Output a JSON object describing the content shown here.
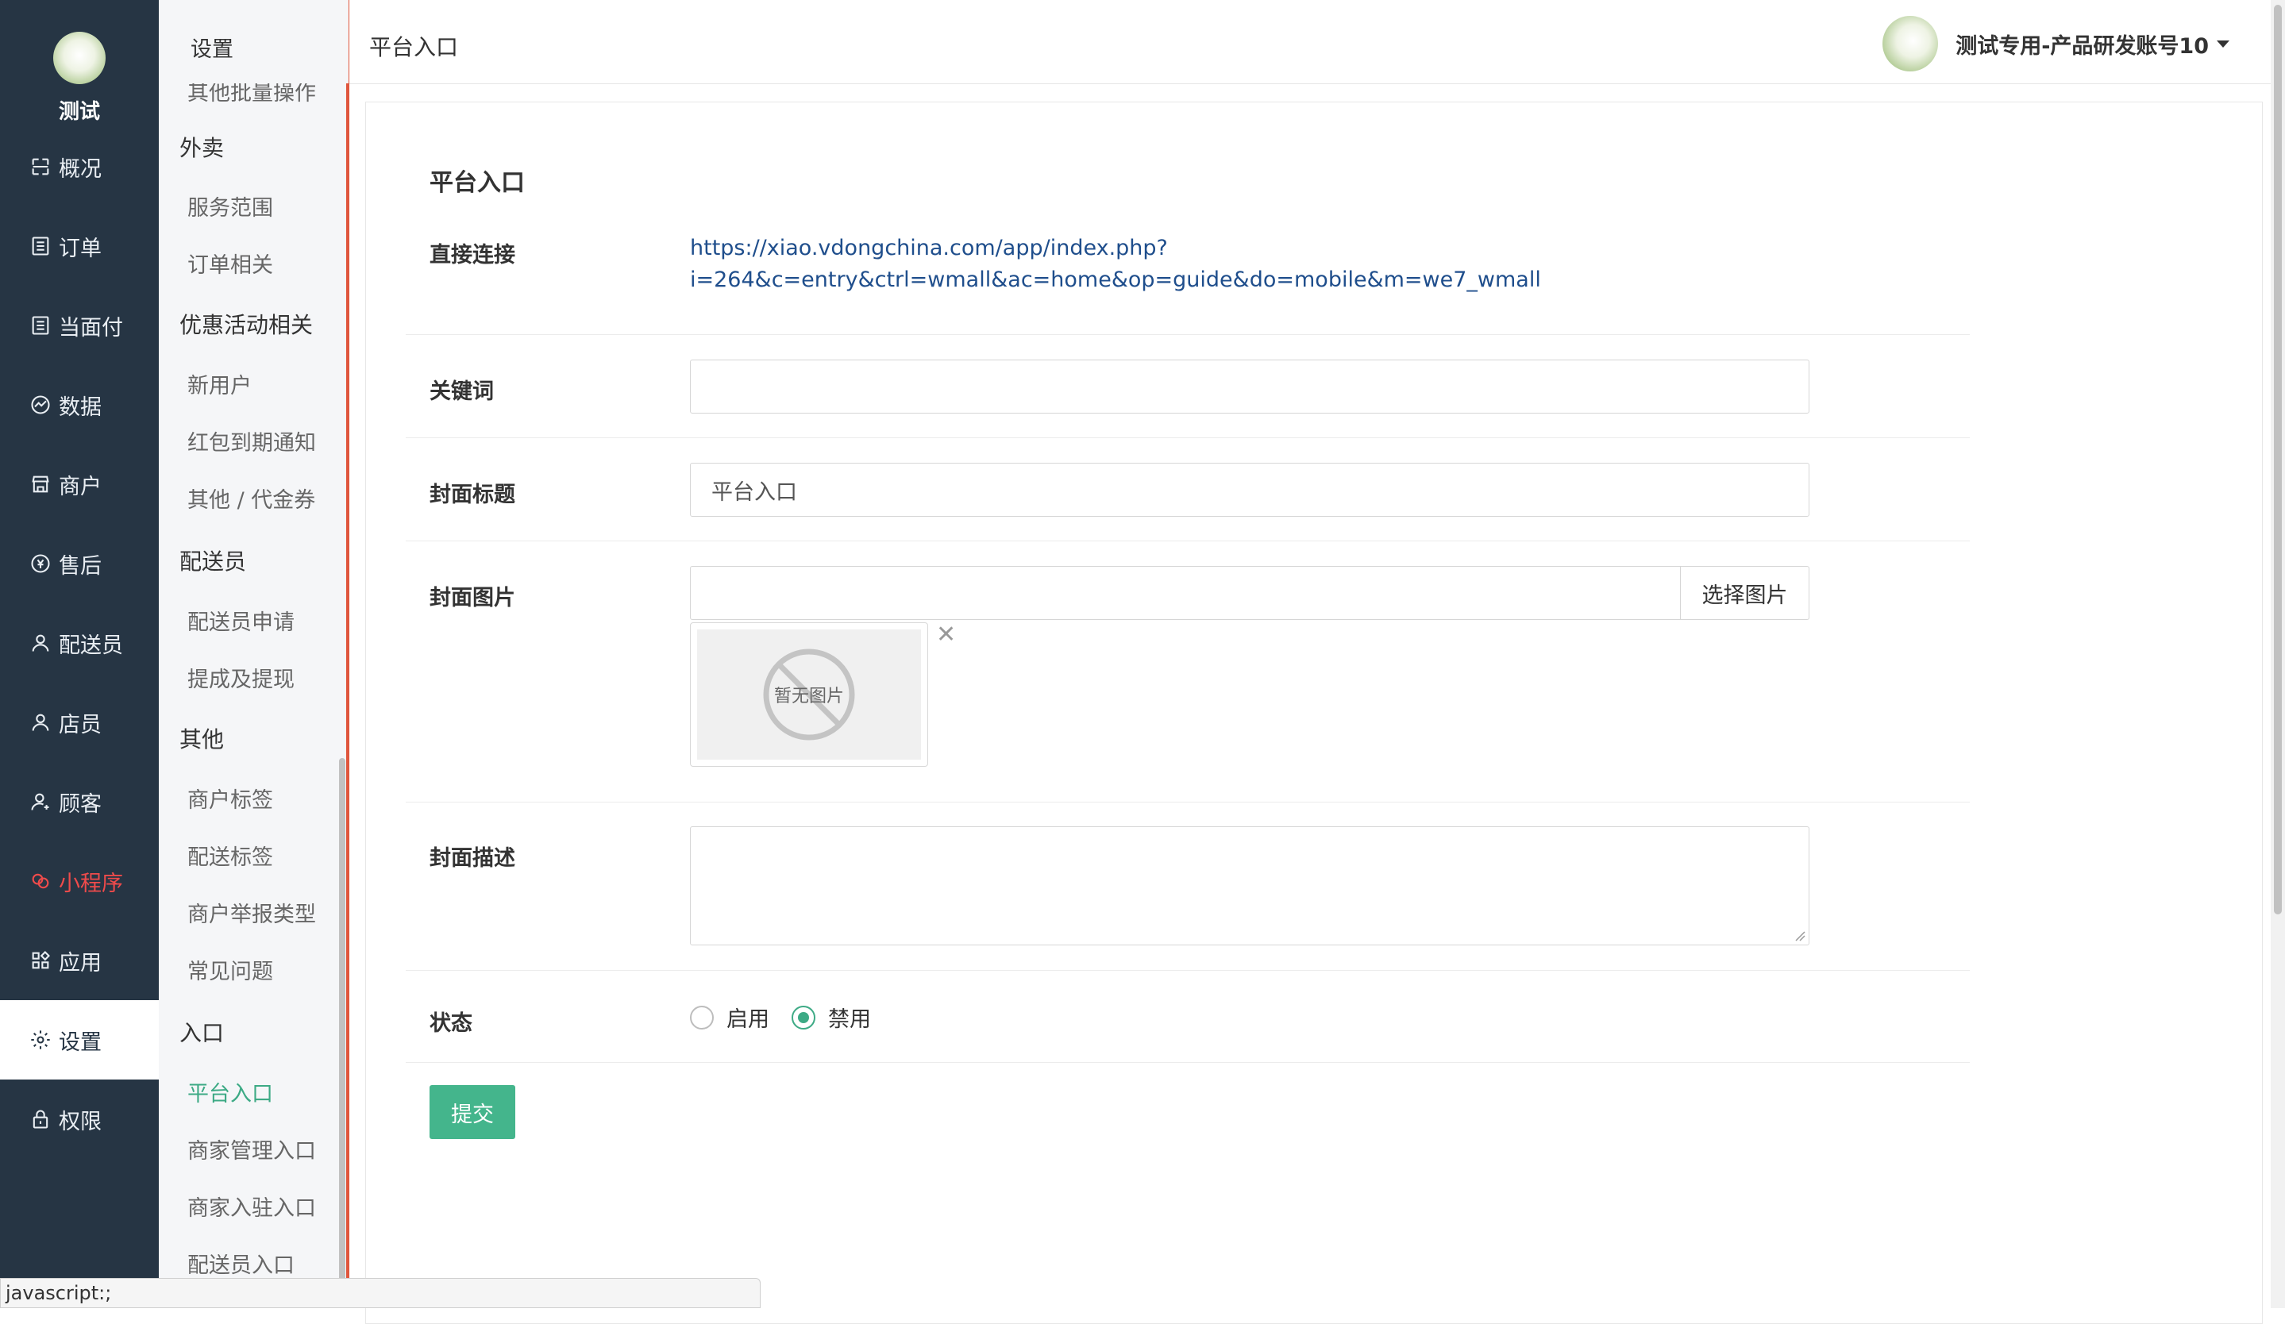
{
  "nav": {
    "logo_text": "测试",
    "items": [
      {
        "label": "概况",
        "icon": "overview-icon"
      },
      {
        "label": "订单",
        "icon": "order-icon"
      },
      {
        "label": "当面付",
        "icon": "payment-icon"
      },
      {
        "label": "数据",
        "icon": "chart-icon"
      },
      {
        "label": "商户",
        "icon": "store-icon"
      },
      {
        "label": "售后",
        "icon": "aftersale-icon"
      },
      {
        "label": "配送员",
        "icon": "user-icon"
      },
      {
        "label": "店员",
        "icon": "user-icon"
      },
      {
        "label": "顾客",
        "icon": "customer-icon"
      },
      {
        "label": "小程序",
        "icon": "miniprogram-icon"
      },
      {
        "label": "应用",
        "icon": "apps-icon"
      },
      {
        "label": "设置",
        "icon": "gear-icon"
      },
      {
        "label": "权限",
        "icon": "lock-icon"
      }
    ],
    "active": "设置",
    "highlight": "小程序"
  },
  "submenu": {
    "title": "设置",
    "cut_item": "其他批量操作",
    "groups": [
      {
        "label": "外卖",
        "items": [
          "服务范围",
          "订单相关"
        ]
      },
      {
        "label": "优惠活动相关",
        "items": [
          "新用户",
          "红包到期通知",
          "其他 / 代金券"
        ]
      },
      {
        "label": "配送员",
        "items": [
          "配送员申请",
          "提成及提现"
        ]
      },
      {
        "label": "其他",
        "items": [
          "商户标签",
          "配送标签",
          "商户举报类型",
          "常见问题"
        ]
      },
      {
        "label": "入口",
        "items": [
          "平台入口",
          "商家管理入口",
          "商家入驻入口",
          "配送员入口"
        ]
      }
    ],
    "active_item": "平台入口"
  },
  "header": {
    "breadcrumb": "平台入口",
    "username": "测试专用-产品研发账号10"
  },
  "form": {
    "title": "平台入口",
    "direct_link_label": "直接连接",
    "direct_link_line1": "https://xiao.vdongchina.com/app/index.php?",
    "direct_link_line2": "i=264&c=entry&ctrl=wmall&ac=home&op=guide&do=mobile&m=we7_wmall",
    "keyword_label": "关键词",
    "keyword_value": "",
    "cover_title_label": "封面标题",
    "cover_title_value": "平台入口",
    "cover_image_label": "封面图片",
    "cover_image_value": "",
    "choose_image_label": "选择图片",
    "no_image_text": "暂无图片",
    "cover_desc_label": "封面描述",
    "cover_desc_value": "",
    "status_label": "状态",
    "status_options": [
      "启用",
      "禁用"
    ],
    "status_selected": "禁用",
    "submit_label": "提交"
  },
  "statusbar": {
    "text": "javascript:;"
  },
  "colors": {
    "nav_bg": "#263544",
    "accent_green": "#3daa85",
    "submit_green": "#44b58c",
    "link_blue": "#1f4e8c",
    "highlight_red": "#e0563d"
  }
}
